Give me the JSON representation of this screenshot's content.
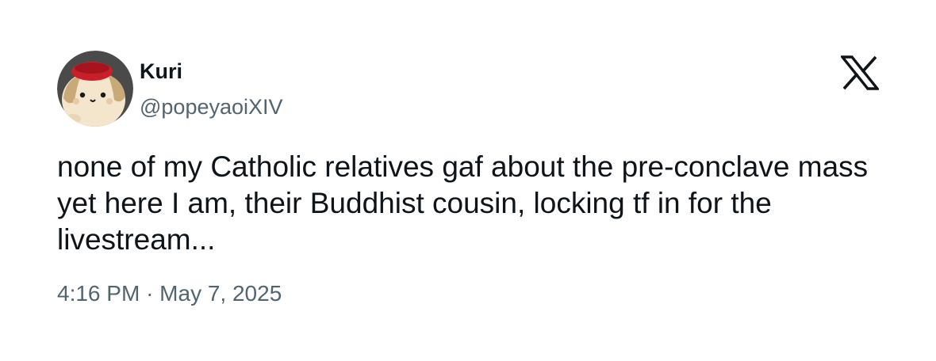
{
  "author": {
    "display_name": "Kuri",
    "handle": "@popeyaoiXIV",
    "avatar_icon": "hamster-avatar-with-red-zucchetto"
  },
  "brand": {
    "logo_icon": "x-logo-icon",
    "logo_color": "#0f1419"
  },
  "tweet": {
    "text": "none of my Catholic relatives gaf about the pre-conclave mass yet here I am, their Buddhist cousin, locking tf in for the livestream...",
    "time": "4:16 PM",
    "separator": "·",
    "date": "May 7, 2025"
  },
  "colors": {
    "text_primary": "#0f1419",
    "text_secondary": "#536471",
    "background": "#ffffff"
  }
}
